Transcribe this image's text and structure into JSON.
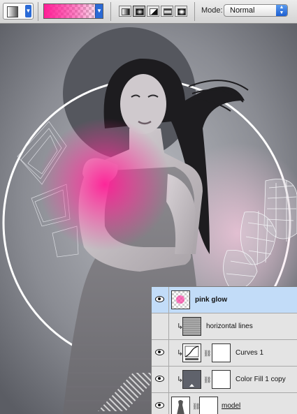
{
  "options_bar": {
    "tool_preset_icon": "gradient-tool-preset-icon",
    "gradient_picker": {
      "colors": [
        "#ff1e96",
        "transparent"
      ]
    },
    "gradient_types": [
      {
        "name": "linear-gradient-icon",
        "selected": false
      },
      {
        "name": "radial-gradient-icon",
        "selected": true
      },
      {
        "name": "angle-gradient-icon",
        "selected": false
      },
      {
        "name": "reflected-gradient-icon",
        "selected": false
      },
      {
        "name": "diamond-gradient-icon",
        "selected": false
      }
    ],
    "mode_label": "Mode:",
    "mode_value": "Normal"
  },
  "canvas": {
    "background_color": "#8a8c92",
    "glow_color": "#ff1e96",
    "ring_color": "#ffffff"
  },
  "layers": [
    {
      "name": "pink glow",
      "selected": true,
      "visible": true,
      "clipped": false,
      "thumb": "checker",
      "mask": false
    },
    {
      "name": "horizontal lines",
      "selected": false,
      "visible": false,
      "clipped": true,
      "thumb": "lines",
      "mask": false
    },
    {
      "name": "Curves 1",
      "selected": false,
      "visible": true,
      "clipped": true,
      "thumb": "curves",
      "mask": true
    },
    {
      "name": "Color Fill 1 copy",
      "selected": false,
      "visible": true,
      "clipped": true,
      "thumb": "gray",
      "mask": true
    },
    {
      "name": "model",
      "selected": false,
      "visible": true,
      "clipped": false,
      "thumb": "white",
      "mask": true
    }
  ],
  "accent_selected_row": "#c2dcf8"
}
